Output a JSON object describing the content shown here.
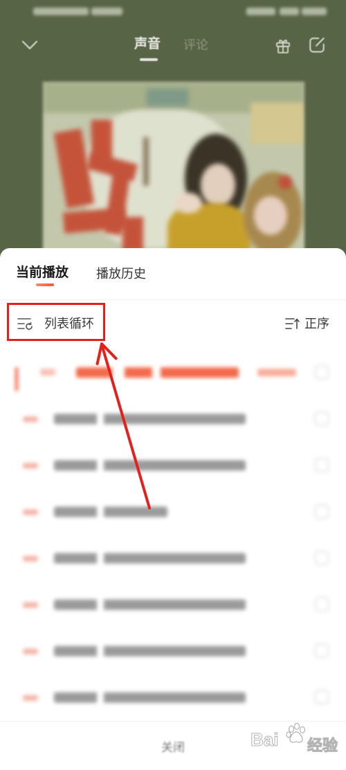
{
  "header": {
    "tabs": [
      {
        "label": "声音",
        "active": true
      },
      {
        "label": "评论",
        "active": false
      }
    ],
    "back_icon": "chevron-down-icon",
    "gift_icon": "gift-icon",
    "share_icon": "share-icon"
  },
  "playlist_sheet": {
    "tabs": [
      {
        "label": "当前播放",
        "active": true
      },
      {
        "label": "播放历史",
        "active": false
      }
    ],
    "play_mode": {
      "label": "列表循环",
      "icon": "list-loop-icon"
    },
    "sort_order": {
      "label": "正序",
      "icon": "sort-icon"
    },
    "close_label": "关闭"
  },
  "colors": {
    "accent": "#f5583a",
    "annotation": "#e4201c",
    "backdrop": "#586446"
  },
  "watermark": {
    "logo_text": "Bai",
    "logo_suffix": "经验"
  }
}
